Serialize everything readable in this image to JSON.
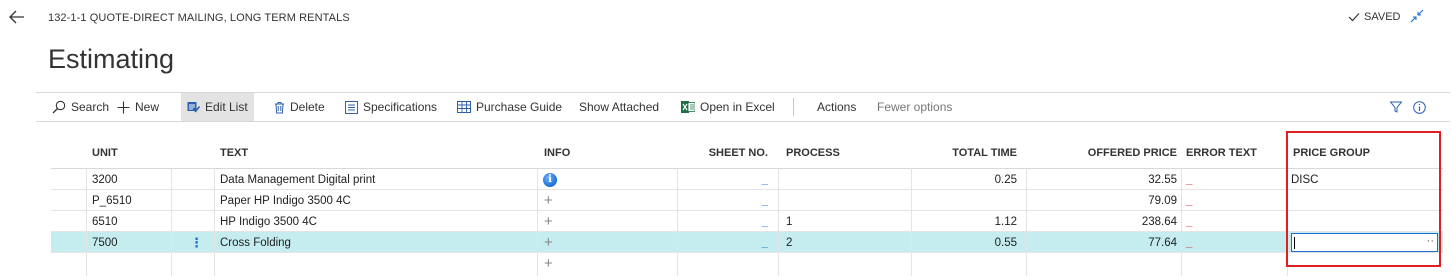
{
  "header": {
    "record_title": "132-1-1 QUOTE-DIRECT MAILING, LONG TERM RENTALS",
    "saved_label": "SAVED",
    "page_title": "Estimating"
  },
  "actions": {
    "search": "Search",
    "new": "New",
    "edit_list": "Edit List",
    "delete": "Delete",
    "specifications": "Specifications",
    "purchase_guide": "Purchase Guide",
    "show_attached": "Show Attached",
    "open_in_excel": "Open in Excel",
    "actions": "Actions",
    "fewer_options": "Fewer options"
  },
  "columns": {
    "unit": "UNIT",
    "text": "TEXT",
    "info": "INFO",
    "sheet_no": "SHEET NO.",
    "process": "PROCESS",
    "total_time": "TOTAL TIME",
    "offered_price": "OFFERED PRICE",
    "error_text": "ERROR TEXT",
    "price_group": "PRICE GROUP"
  },
  "rows": [
    {
      "unit": "3200",
      "text": "Data Management Digital print",
      "info": "info",
      "sheet_no": "_",
      "process": "",
      "total_time": "0.25",
      "offered_price": "32.55",
      "error_text": "_",
      "price_group": "DISC"
    },
    {
      "unit": "P_6510",
      "text": "Paper HP Indigo 3500 4C",
      "info": "+",
      "sheet_no": "_",
      "process": "",
      "total_time": "",
      "offered_price": "79.09",
      "error_text": "_",
      "price_group": ""
    },
    {
      "unit": "6510",
      "text": "HP Indigo 3500 4C",
      "info": "+",
      "sheet_no": "_",
      "process": "1",
      "total_time": "1.12",
      "offered_price": "238.64",
      "error_text": "_",
      "price_group": ""
    },
    {
      "unit": "7500",
      "text": "Cross Folding",
      "info": "+",
      "sheet_no": "_",
      "process": "2",
      "total_time": "0.55",
      "offered_price": "77.64",
      "error_text": "_",
      "price_group": ""
    },
    {
      "unit": "",
      "text": "",
      "info": "+",
      "sheet_no": "",
      "process": "",
      "total_time": "",
      "offered_price": "",
      "error_text": "",
      "price_group": ""
    }
  ],
  "selected_row_menu": "⋮",
  "edit_ellipsis": "··",
  "colors": {
    "accent": "#1a6ed8",
    "selected_row": "#c5ecee",
    "error_dash": "#d13438",
    "highlight_box": "#e02020"
  }
}
